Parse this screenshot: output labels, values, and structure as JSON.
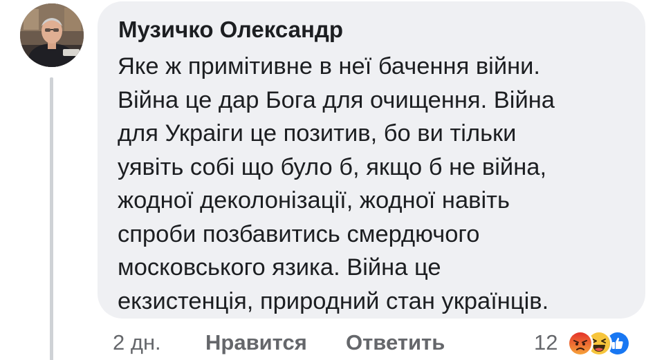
{
  "comment": {
    "author": "Музичко Олександр",
    "text_lines": [
      "Яке ж примітивне в неї бачення війни.",
      "Війна це дар Бога для очищення. Війна",
      "для Украіги це позитив, бо ви тільки",
      "уявіть собі що було б, якщо б не війна,",
      "жодної деколонізації, жодної навіть",
      "спроби позбавитись смердючого",
      "московського язика. Війна це",
      "екзистенція, природний стан українців."
    ],
    "time": "2 дн.",
    "like_label": "Нравится",
    "reply_label": "Ответить",
    "reaction_count": "12",
    "reaction_icons": [
      "angry-icon",
      "haha-icon",
      "like-icon"
    ]
  },
  "colors": {
    "bubble": "#eff0f3",
    "text": "#1c1e21",
    "meta": "#65676b",
    "thread_line": "#cfd2d6",
    "like_blue": "#1877f2",
    "angry_top": "#e4332a",
    "angry_bottom": "#f6a23a",
    "haha_yellow": "#f7c53c"
  }
}
